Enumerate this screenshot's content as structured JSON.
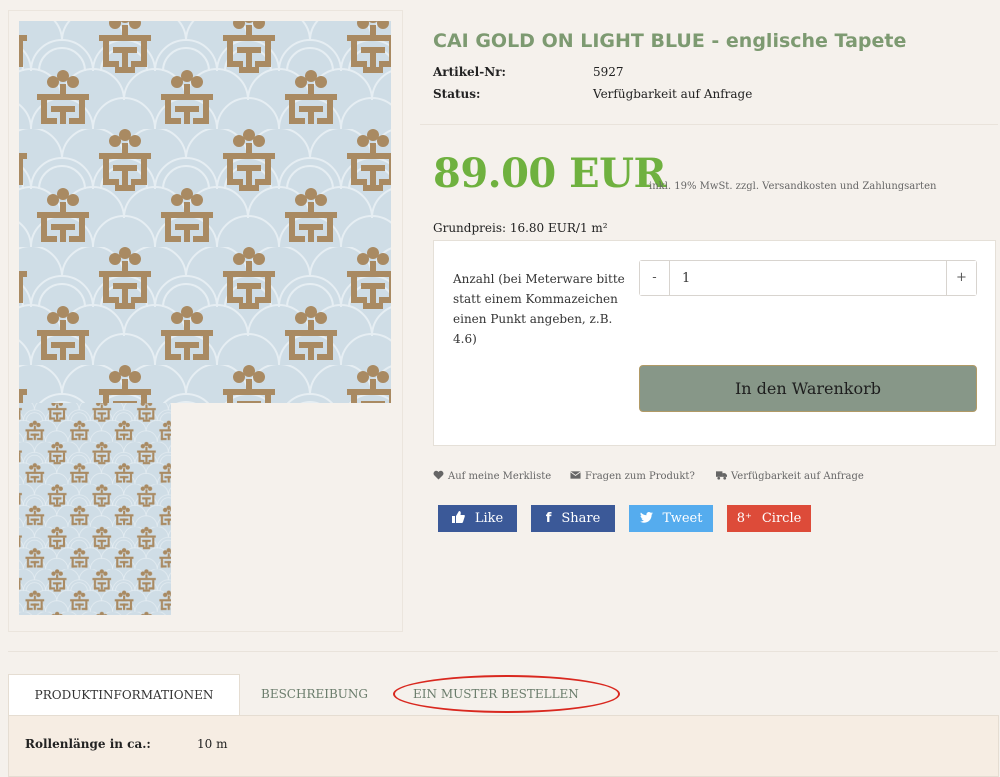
{
  "product": {
    "title": "CAI GOLD ON LIGHT BLUE - englische Tapete",
    "details": [
      {
        "label": "Artikel-Nr:",
        "value": "5927"
      },
      {
        "label": "Status:",
        "value": "Verfügbarkeit auf Anfrage"
      }
    ],
    "price": "89.00 EUR",
    "tax_note": "inkl. 19% MwSt. zzgl. Versandkosten und Zahlungsarten",
    "base_price": "Grundpreis: 16.80 EUR/1 m²"
  },
  "cart": {
    "quantity_label": "Anzahl (bei Meterware bitte statt einem Kommazeichen einen Punkt angeben, z.B. 4.6)",
    "minus": "-",
    "plus": "+",
    "quantity_value": "1",
    "add_button": "In den Warenkorb"
  },
  "links": {
    "wishlist": "Auf meine Merkliste",
    "question": "Fragen zum Produkt?",
    "availability": "Verfügbarkeit auf Anfrage"
  },
  "social": {
    "like": "Like",
    "share": "Share",
    "tweet": "Tweet",
    "circle": "Circle",
    "gplus_symbol": "8⁺"
  },
  "tabs": [
    "PRODUKTINFORMATIONEN",
    "BESCHREIBUNG",
    "EIN MUSTER BESTELLEN"
  ],
  "info_rows": [
    {
      "label": "Rollenlänge in ca.:",
      "value": "10 m"
    }
  ],
  "colors": {
    "title": "#7d9a71",
    "price": "#6fb13f",
    "cart_button": "#879788",
    "facebook": "#3b5998",
    "twitter": "#55acee",
    "gplus": "#dd4b39",
    "pattern_background": "#cfdde6",
    "pattern_gold": "#a98a62",
    "annotation": "#d9281f"
  }
}
